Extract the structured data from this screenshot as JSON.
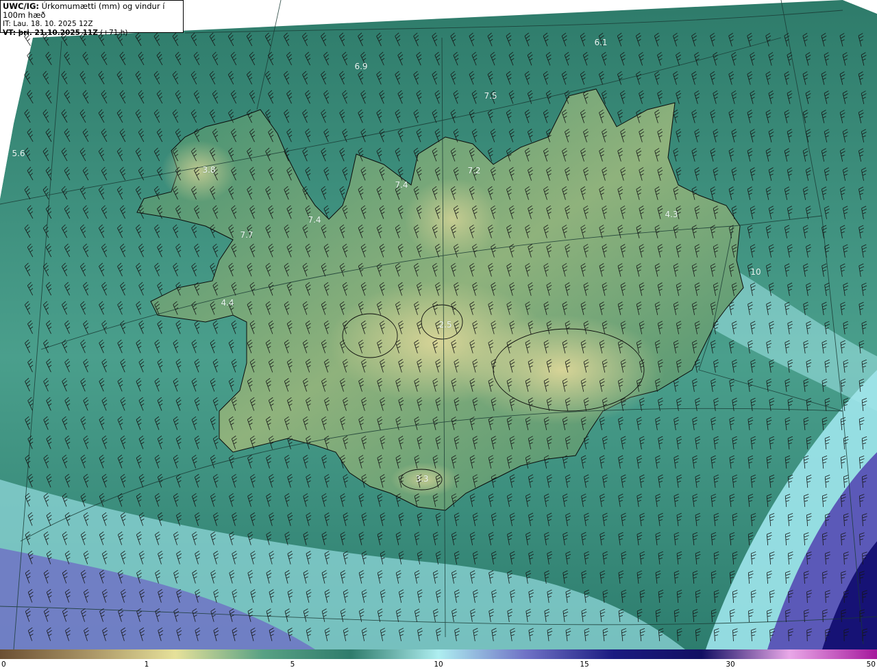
{
  "header": {
    "product": "UWC/IG:",
    "description": "Úrkomumætti (mm) og vindur í 100m hæð",
    "initial_time": "IT: Lau. 18. 10. 2025 12Z",
    "valid_prefix": "VT: þri. 21.10.2025 11Z",
    "valid_suffix": "(+71 h)"
  },
  "point_values": [
    {
      "label": "6.1",
      "pos": "n-east"
    },
    {
      "label": "6.9",
      "pos": "north"
    },
    {
      "label": "7.5",
      "pos": "north-center"
    },
    {
      "label": "5.6",
      "pos": "far-west"
    },
    {
      "label": "3.8",
      "pos": "westfjords"
    },
    {
      "label": "7.2",
      "pos": "north-fjord"
    },
    {
      "label": "7.4",
      "pos": "north-peninsula"
    },
    {
      "label": "7.4",
      "pos": "west-north"
    },
    {
      "label": "7.7",
      "pos": "west"
    },
    {
      "label": "4.3",
      "pos": "east"
    },
    {
      "label": "10",
      "pos": "east-coast"
    },
    {
      "label": "4.4",
      "pos": "snaefellsnes"
    },
    {
      "label": "2.5",
      "pos": "central-highland"
    },
    {
      "label": "3.3",
      "pos": "south"
    }
  ],
  "legend": {
    "ticks": [
      "0",
      "1",
      "5",
      "10",
      "15",
      "30",
      "50"
    ],
    "colors": [
      "#6b4f33",
      "#a89364",
      "#e6e19a",
      "#58a184",
      "#2f7c6c",
      "#aeeef0",
      "#6f72c6",
      "#1a1a80",
      "#120f63",
      "#e9a8e8",
      "#a5189c"
    ]
  },
  "colors": {
    "sea": "#2f7c6c",
    "land_low": "#3f8f73",
    "land_high": "#c9cd8e",
    "high_precip": "#aeeef0",
    "very_high": "#6f72c6",
    "extreme": "#141070"
  }
}
